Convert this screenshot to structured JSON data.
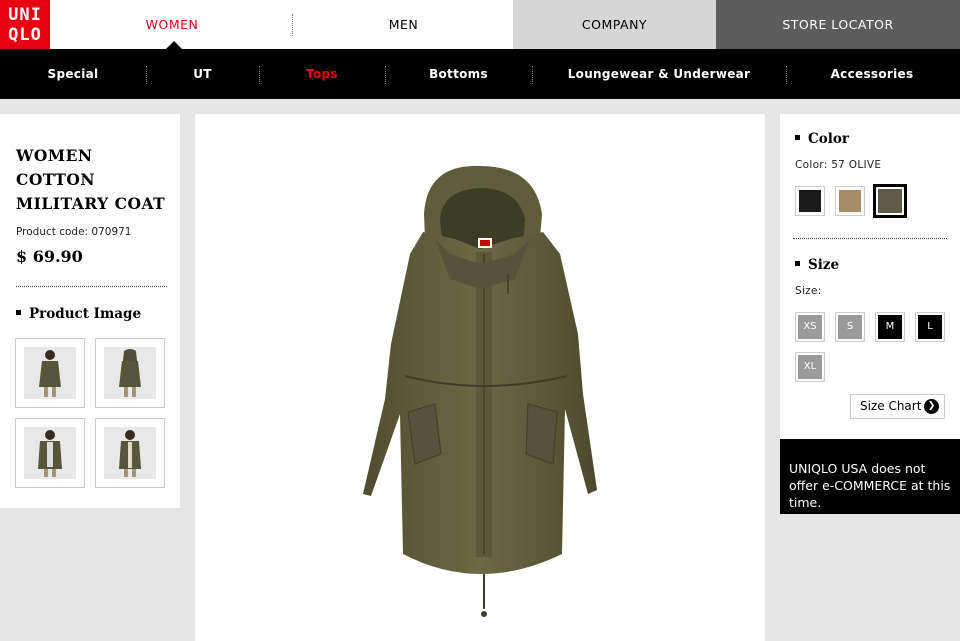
{
  "brand": {
    "logo_line1": "UNI",
    "logo_line2": "QLO",
    "color": "#e60012"
  },
  "top_nav": {
    "women": "WOMEN",
    "men": "MEN",
    "company": "COMPANY",
    "store_locator": "STORE LOCATOR"
  },
  "sub_nav": [
    "Special",
    "UT",
    "Tops",
    "Bottoms",
    "Loungewear & Underwear",
    "Accessories"
  ],
  "sub_nav_active": "Tops",
  "product": {
    "title_line1": "WOMEN",
    "title_line2": "COTTON",
    "title_line3": "MILITARY COAT",
    "code": "Product code: 070971",
    "price": "$ 69.90",
    "image_heading": "Product Image"
  },
  "color": {
    "heading": "Color",
    "selected_label": "Color: 57 OLIVE",
    "swatches": [
      {
        "name": "black",
        "hex": "#1a1a1a"
      },
      {
        "name": "beige",
        "hex": "#a58d68"
      },
      {
        "name": "olive",
        "hex": "#5d5a46",
        "selected": true
      }
    ]
  },
  "size": {
    "heading": "Size",
    "label": "Size:",
    "options": [
      {
        "label": "XS",
        "available": false
      },
      {
        "label": "S",
        "available": false
      },
      {
        "label": "M",
        "available": true
      },
      {
        "label": "L",
        "available": true
      },
      {
        "label": "XL",
        "available": false
      }
    ],
    "chart_link": "Size Chart"
  },
  "notice": "UNIQLO USA does not offer e-COMMERCE at this time."
}
